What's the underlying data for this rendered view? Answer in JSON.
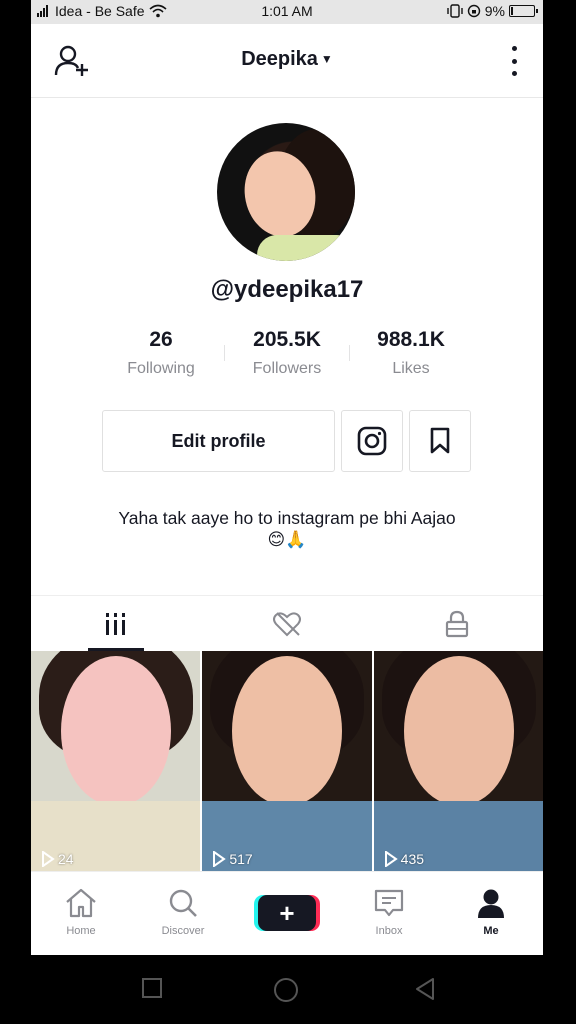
{
  "status_bar": {
    "carrier": "Idea - Be Safe",
    "time": "1:01 AM",
    "battery": "9%",
    "battery_level": 0.09
  },
  "header": {
    "title": "Deepika",
    "add_friend_icon": "person-plus-icon",
    "more_icon": "vertical-dots-icon"
  },
  "profile": {
    "username": "@ydeepika17",
    "stats": [
      {
        "value": "26",
        "label": "Following"
      },
      {
        "value": "205.5K",
        "label": "Followers"
      },
      {
        "value": "988.1K",
        "label": "Likes"
      }
    ],
    "edit_label": "Edit profile",
    "bio_text": "Yaha tak aaye ho to instagram pe bhi Aajao",
    "bio_emoji": "😊🙏"
  },
  "tabs": [
    {
      "name": "grid-icon",
      "active": true
    },
    {
      "name": "liked-hidden-icon",
      "active": false
    },
    {
      "name": "lock-icon",
      "active": false
    }
  ],
  "videos": [
    {
      "views": "24"
    },
    {
      "views": "517"
    },
    {
      "views": "435"
    }
  ],
  "bottom_nav": [
    {
      "label": "Home",
      "icon": "home-icon"
    },
    {
      "label": "Discover",
      "icon": "search-icon"
    },
    {
      "label": "",
      "icon": "plus-icon"
    },
    {
      "label": "Inbox",
      "icon": "inbox-icon"
    },
    {
      "label": "Me",
      "icon": "person-icon",
      "active": true
    }
  ],
  "colors": {
    "text": "#161823",
    "secondary": "#8a8b91",
    "accent_cyan": "#25f4ee",
    "accent_red": "#fe2c55"
  }
}
